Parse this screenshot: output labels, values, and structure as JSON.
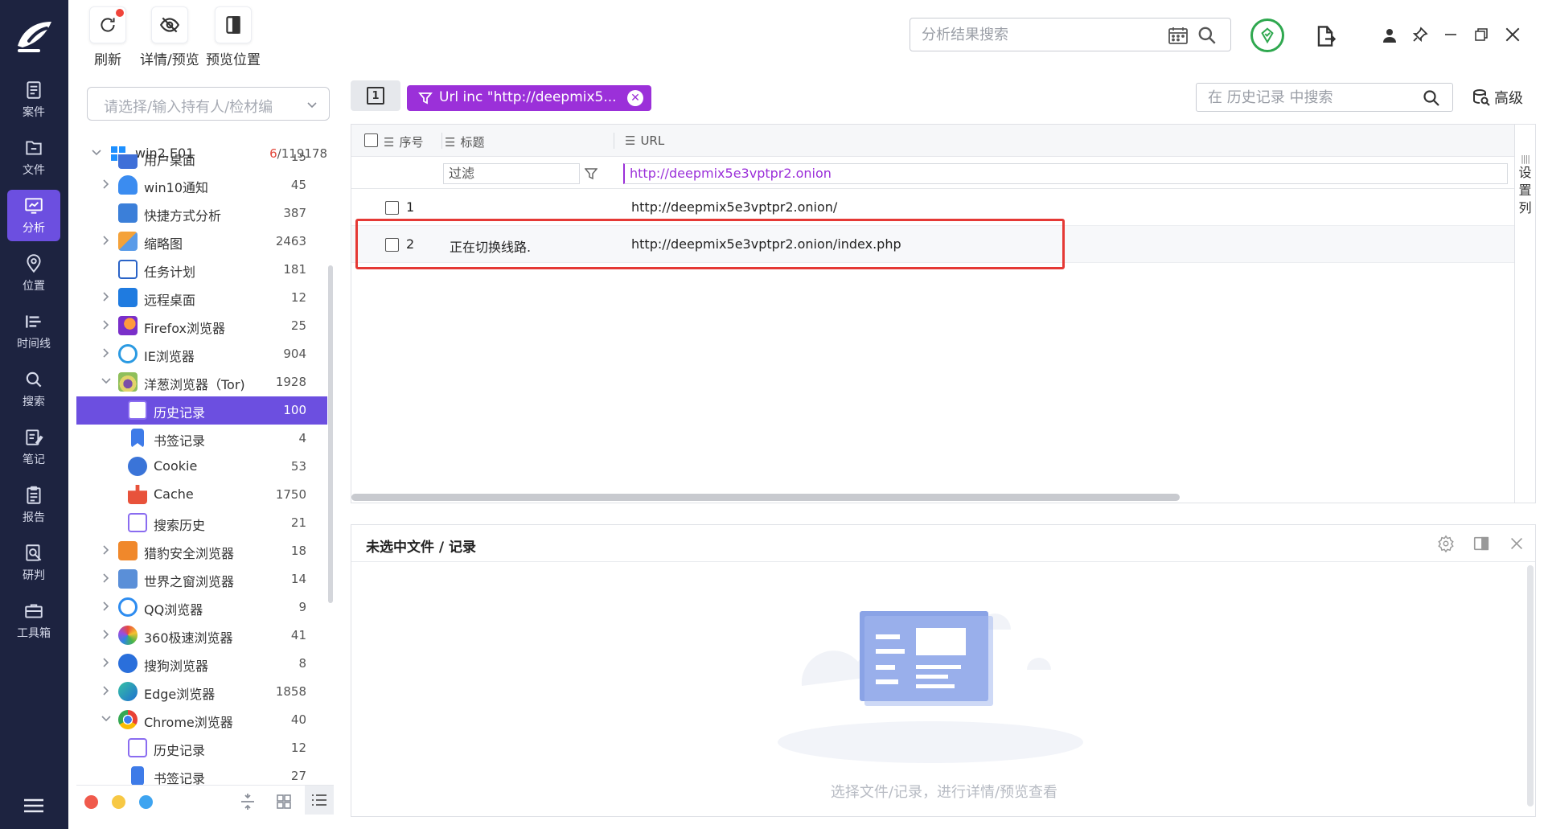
{
  "rail": {
    "items": [
      {
        "label": "案件",
        "icon": "case-icon"
      },
      {
        "label": "文件",
        "icon": "folder-icon"
      },
      {
        "label": "分析",
        "icon": "analysis-icon",
        "active": true
      },
      {
        "label": "位置",
        "icon": "location-icon"
      },
      {
        "label": "时间线",
        "icon": "timeline-icon"
      },
      {
        "label": "搜索",
        "icon": "search-icon"
      },
      {
        "label": "笔记",
        "icon": "notes-icon"
      },
      {
        "label": "报告",
        "icon": "report-icon"
      },
      {
        "label": "研判",
        "icon": "judge-icon"
      },
      {
        "label": "工具箱",
        "icon": "toolbox-icon"
      }
    ]
  },
  "toolbar": {
    "refresh_label": "刷新",
    "detail_label": "详情/预览",
    "preview_pos_label": "预览位置",
    "search_placeholder": "分析结果搜索"
  },
  "tree": {
    "holder_placeholder": "请选择/输入持有人/检材编",
    "root": {
      "name": "win2.E01",
      "count_highlight": "6",
      "count_total": "/119178"
    },
    "items": [
      {
        "name": "用户桌面",
        "count": "15"
      },
      {
        "name": "win10通知",
        "count": "45"
      },
      {
        "name": "快捷方式分析",
        "count": "387"
      },
      {
        "name": "缩略图",
        "count": "2463"
      },
      {
        "name": "任务计划",
        "count": "181"
      },
      {
        "name": "远程桌面",
        "count": "12"
      },
      {
        "name": "Firefox浏览器",
        "count": "25"
      },
      {
        "name": "IE浏览器",
        "count": "904"
      },
      {
        "name": "洋葱浏览器（Tor)",
        "count": "1928"
      },
      {
        "name": "历史记录",
        "count": "100"
      },
      {
        "name": "书签记录",
        "count": "4"
      },
      {
        "name": "Cookie",
        "count": "53"
      },
      {
        "name": "Cache",
        "count": "1750"
      },
      {
        "name": "搜索历史",
        "count": "21"
      },
      {
        "name": "猎豹安全浏览器",
        "count": "18"
      },
      {
        "name": "世界之窗浏览器",
        "count": "14"
      },
      {
        "name": "QQ浏览器",
        "count": "9"
      },
      {
        "name": "360极速浏览器",
        "count": "41"
      },
      {
        "name": "搜狗浏览器",
        "count": "8"
      },
      {
        "name": "Edge浏览器",
        "count": "1858"
      },
      {
        "name": "Chrome浏览器",
        "count": "40"
      },
      {
        "name": "历史记录",
        "count": "12"
      },
      {
        "name": "书签记录",
        "count": "27"
      }
    ]
  },
  "records": {
    "filter_chip": "Url inc \"http://deepmix5...",
    "history_search_placeholder": "在 历史记录 中搜索",
    "advanced_label": "高级",
    "columns": {
      "index": "序号",
      "title": "标题",
      "url": "URL"
    },
    "title_filter": "过滤",
    "url_filter": "http://deepmix5e3vptpr2.onion",
    "rows": [
      {
        "num": "1",
        "title": "",
        "url": "http://deepmix5e3vptpr2.onion/"
      },
      {
        "num": "2",
        "title": "正在切换线路.",
        "url": "http://deepmix5e3vptpr2.onion/index.php"
      }
    ],
    "settings_col": [
      "设",
      "置",
      "列"
    ]
  },
  "preview": {
    "title": "未选中文件 / 记录",
    "hint": "选择文件/记录，进行详情/预览查看"
  },
  "colors": {
    "rail_bg": "#1d2340",
    "accent": "#6c4fe0",
    "filter_chip": "#9b30d9",
    "highlight_box": "#e53935"
  }
}
